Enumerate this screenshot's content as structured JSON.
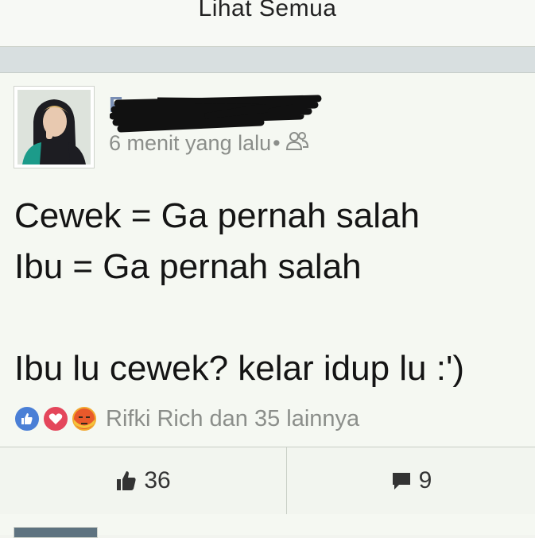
{
  "top_card": {
    "see_all": "Lihat Semua"
  },
  "post": {
    "author_name": "Fa",
    "timestamp": "6 menit yang lalu",
    "separator": "•",
    "audience_icon": "friends-icon",
    "body": "Cewek = Ga pernah salah\nIbu = Ga pernah salah\n\nIbu lu cewek? kelar idup lu :')",
    "reactions": {
      "icons": [
        "like-icon",
        "love-icon",
        "angry-icon"
      ],
      "summary": "Rifki Rich dan 35 lainnya"
    },
    "actions": {
      "like_count": "36",
      "comment_count": "9"
    }
  },
  "colors": {
    "like_blue": "#4a7fd6",
    "love_red": "#e4465b",
    "angry_orange": "#f2a72f",
    "name_blue": "#7a8fb5"
  }
}
